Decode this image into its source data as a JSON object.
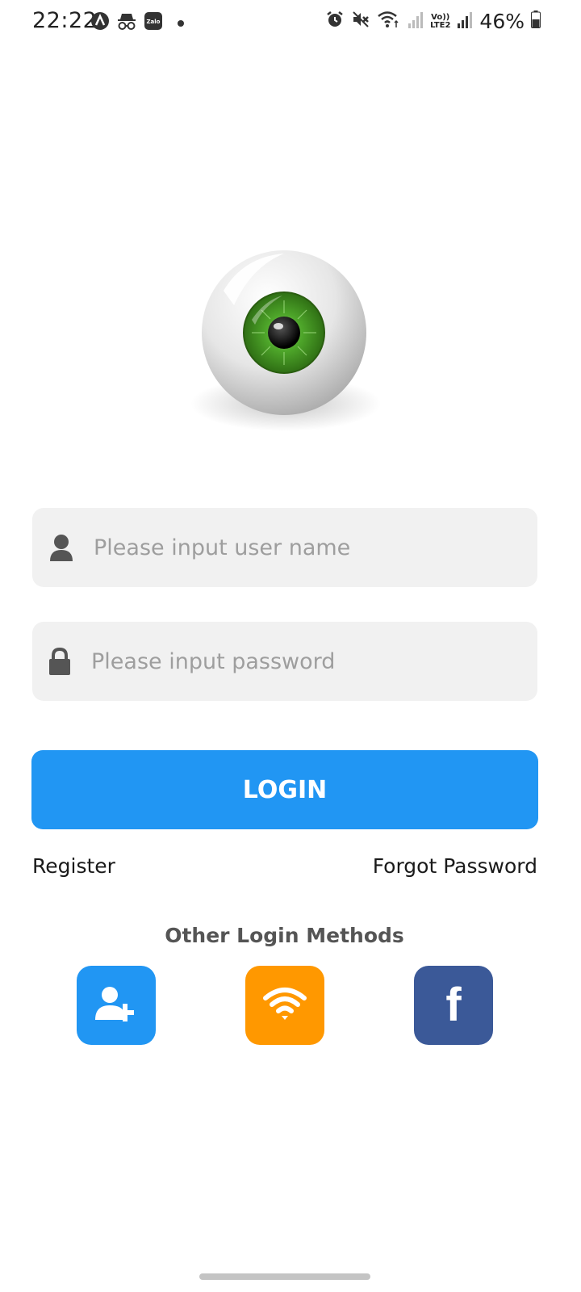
{
  "status_bar": {
    "time": "22:22",
    "lte_top": "Vo))",
    "lte_bottom": "LTE2",
    "battery": "46%",
    "icons": [
      "app-a-icon",
      "incognito-icon",
      "zalo-icon",
      "notification-dot",
      "alarm-icon",
      "mute-icon",
      "wifi-icon",
      "signal-icon",
      "signal-icon",
      "battery-icon"
    ],
    "zalo_label": "Zalo"
  },
  "login_form": {
    "username_placeholder": "Please input user name",
    "password_placeholder": "Please input password",
    "login_label": "LOGIN",
    "register_label": "Register",
    "forgot_label": "Forgot Password"
  },
  "other_methods": {
    "title": "Other Login Methods",
    "buttons": [
      {
        "name": "add-user",
        "color": "#2196f3"
      },
      {
        "name": "wifi",
        "color": "#ff9800"
      },
      {
        "name": "facebook",
        "label": "f",
        "color": "#3b5998"
      }
    ]
  },
  "colors": {
    "primary": "#2196f3",
    "orange": "#ff9800",
    "facebook": "#3b5998",
    "input_bg": "#f1f1f1",
    "iris": "#3f8f1e"
  }
}
